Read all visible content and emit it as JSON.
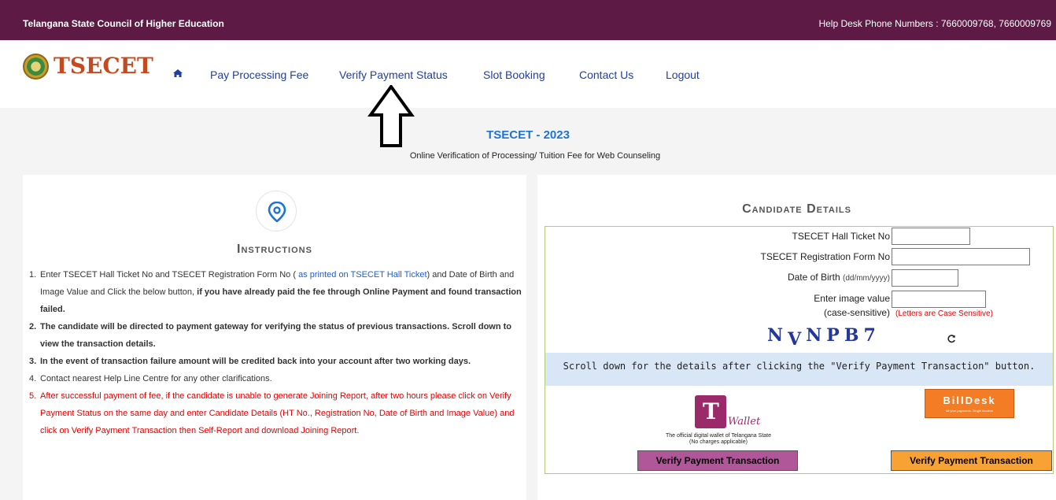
{
  "topbar": {
    "org": "Telangana State Council of Higher Education",
    "help": "Help Desk Phone Numbers : 7660009768, 7660009769"
  },
  "nav": {
    "logo": "TSECET",
    "home_icon": "home-icon",
    "links": [
      "Pay Processing Fee",
      "Verify Payment Status",
      "Slot Booking",
      "Contact Us",
      "Logout"
    ]
  },
  "annotation": {
    "arrow_icon": "up-arrow-icon"
  },
  "page": {
    "title": "TSECET - 2023",
    "subtitle": "Online Verification of Processing/ Tuition Fee for Web Counseling"
  },
  "instructions": {
    "icon": "location-pin-icon",
    "heading": "Instructions",
    "items": [
      {
        "num": "1.",
        "a": "Enter TSECET Hall Ticket No and TSECET Registration Form No ( ",
        "link": "as printed on TSECET Hall Ticket",
        "b": ") and Date of Birth and Image Value and Click the below button, ",
        "bold": "if you have already paid the fee through Online Payment and found transaction failed."
      },
      {
        "num": "2.",
        "text": "The candidate will be directed to payment gateway for verifying the status of previous transactions. Scroll down to view the transaction details."
      },
      {
        "num": "3.",
        "text": "In the event of transaction failure amount will be credited back into your account after two working days."
      },
      {
        "num": "4.",
        "text": "Contact nearest Help Line Centre for any other clarifications."
      },
      {
        "num": "5.",
        "text": "After successful payment of fee, if the candidate is unable to generate Joining Report, after two hours please click on Verify Payment Status on the same day and enter Candidate Details (HT No., Registration No, Date of Birth and Image Value) and click on Verify Payment Transaction then Self-Report and download Joining Report."
      }
    ]
  },
  "candidate": {
    "heading": "Candidate Details",
    "hall_ticket_label": "TSECET Hall Ticket No",
    "reg_form_label": "TSECET Registration Form No",
    "dob_label": "Date of Birth",
    "dob_hint": "(dd/mm/yyyy)",
    "image_label": "Enter image value",
    "case_label": "(case-sensitive)",
    "case_note": "(Letters are Case Sensitive)",
    "captcha": [
      "N",
      "V",
      "N",
      "P",
      "B",
      "7"
    ],
    "refresh_icon": "refresh-icon",
    "scroll_note": "Scroll down for the details after clicking the \"Verify Payment Transaction\" button.",
    "twallet": {
      "logo_icon": "t-wallet-logo-icon",
      "logo_letter": "T",
      "logo_script": "Wallet",
      "caption1": "The official digital wallet of Telangana State",
      "caption2": "(No charges applicable)"
    },
    "billdesk": {
      "logo_icon": "billdesk-logo-icon",
      "name": "BillDesk",
      "tagline": "All your payments. Single location"
    },
    "verify_btn_twallet": "Verify Payment Transaction",
    "verify_btn_billdesk": "Verify Payment Transaction"
  }
}
